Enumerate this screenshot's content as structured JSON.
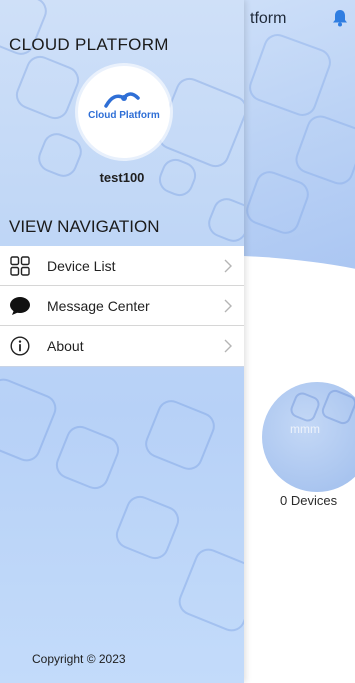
{
  "background": {
    "title": "tform",
    "device_circle_label": "mmm",
    "devices_count": "0 Devices"
  },
  "drawer": {
    "title": "CLOUD PLATFORM",
    "logo_text": "Cloud Platform",
    "username": "test100",
    "nav_title": "VIEW NAVIGATION",
    "items": [
      {
        "label": "Device List",
        "icon": "grid-icon"
      },
      {
        "label": "Message Center",
        "icon": "chat-bubble-icon"
      },
      {
        "label": "About",
        "icon": "info-icon"
      }
    ],
    "copyright": "Copyright © 2023"
  },
  "colors": {
    "accent": "#2f7de1",
    "drawer_bg": "#c3dbfa"
  }
}
